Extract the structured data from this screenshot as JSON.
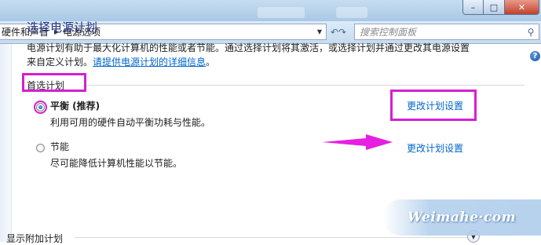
{
  "window": {
    "minimize_glyph": "–",
    "maximize_glyph": "□",
    "close_glyph": "✕"
  },
  "address_bar": {
    "breadcrumb": [
      "硬件和声音",
      "电源选项"
    ],
    "search_placeholder": "搜索控制面板"
  },
  "main": {
    "help_glyph": "?",
    "title": "选择电源计划",
    "description_line1": "电源计划有助于最大化计算机的性能或者节能。通过选择计划将其激活，或选择计划并通过更改其电源设置",
    "description_line2_prefix": "来自定义计划。",
    "description_link": "请提供电源计划的详细信息",
    "description_line2_suffix": "。",
    "preferred_section": "首选计划",
    "plans": [
      {
        "name": "平衡 (推荐)",
        "description": "利用可用的硬件自动平衡功耗与性能。",
        "selected": true,
        "change_link": "更改计划设置"
      },
      {
        "name": "节能",
        "description": "尽可能降低计算机性能以节能。",
        "selected": false,
        "change_link": "更改计划设置"
      }
    ],
    "additional_section": "显示附加计划"
  },
  "annotations": {
    "highlight_color": "#d51fd0"
  },
  "watermark": "Weimahe·com"
}
